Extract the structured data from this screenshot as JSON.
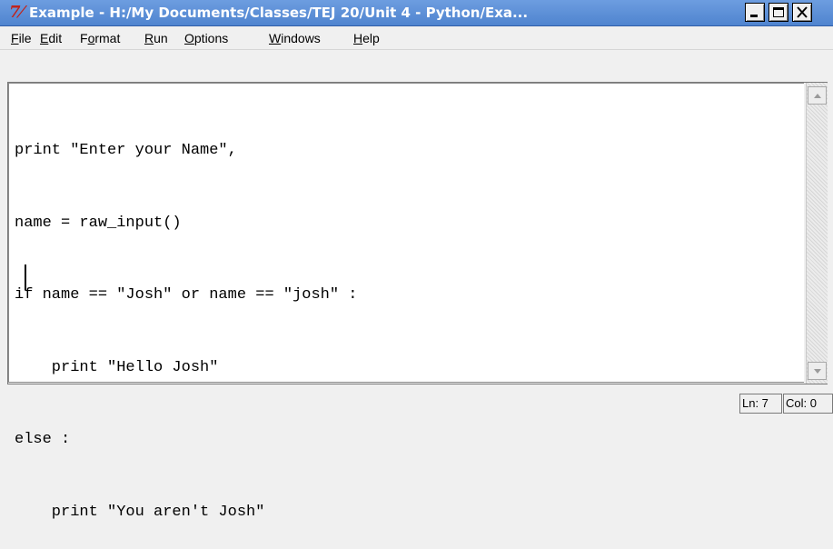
{
  "window": {
    "title": "Example - H:/My Documents/Classes/TEJ 20/Unit 4 - Python/Exa...",
    "app_icon": "tk-feather-icon",
    "controls": [
      "minimize",
      "maximize",
      "close"
    ]
  },
  "menubar": {
    "items": [
      {
        "label_u": "F",
        "label_rest": "ile"
      },
      {
        "label_u": "E",
        "label_rest": "dit"
      },
      {
        "label_pre": "F",
        "label_u": "o",
        "label_rest": "rmat"
      },
      {
        "label_u": "R",
        "label_rest": "un"
      },
      {
        "label_u": "O",
        "label_rest": "ptions"
      },
      {
        "label_u": "W",
        "label_rest": "indows"
      },
      {
        "label_u": "H",
        "label_rest": "elp"
      }
    ]
  },
  "editor": {
    "lines": [
      "print \"Enter your Name\",",
      "name = raw_input()",
      "if name == \"Josh\" or name == \"josh\" :",
      "    print \"Hello Josh\"",
      "else :",
      "    print \"You aren't Josh\""
    ]
  },
  "statusbar": {
    "line": "Ln: 7",
    "column": "Col: 0"
  },
  "colors": {
    "titlebar": "#4f84cf",
    "icon": "#c0241c"
  }
}
